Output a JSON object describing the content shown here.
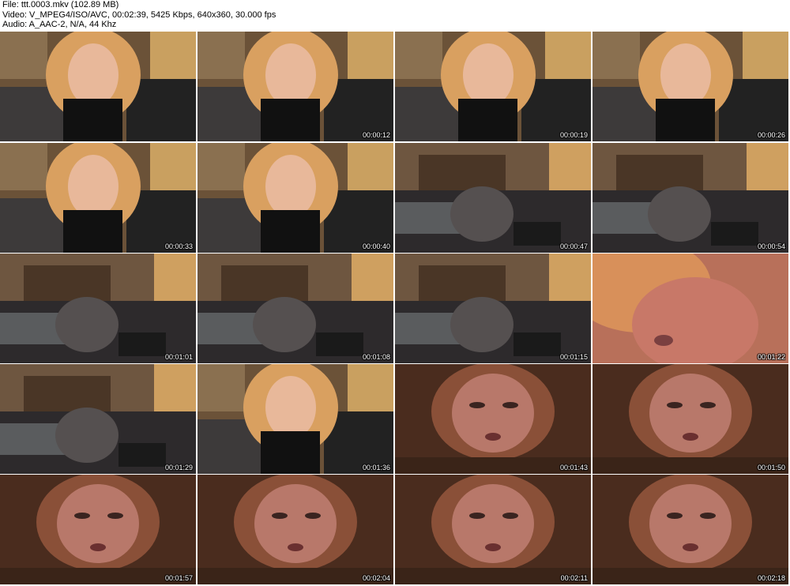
{
  "header": {
    "file_line": "File: ttt.0003.mkv (102.89 MB)",
    "video_line": "Video: V_MPEG4/ISO/AVC, 00:02:39, 5425 Kbps, 640x360, 30.000 fps",
    "audio_line": "Audio: A_AAC-2, N/A, 44 Khz"
  },
  "thumbnails": [
    {
      "time": "",
      "scene": "room-hair"
    },
    {
      "time": "00:00:12",
      "scene": "room-hair"
    },
    {
      "time": "00:00:19",
      "scene": "room-hair"
    },
    {
      "time": "00:00:26",
      "scene": "room-hair"
    },
    {
      "time": "00:00:33",
      "scene": "room-hair"
    },
    {
      "time": "00:00:40",
      "scene": "room-hair"
    },
    {
      "time": "00:00:47",
      "scene": "room-wide"
    },
    {
      "time": "00:00:54",
      "scene": "room-wide"
    },
    {
      "time": "00:01:01",
      "scene": "room-wide"
    },
    {
      "time": "00:01:08",
      "scene": "room-wide"
    },
    {
      "time": "00:01:15",
      "scene": "room-wide"
    },
    {
      "time": "00:01:22",
      "scene": "closeup-red"
    },
    {
      "time": "00:01:29",
      "scene": "room-wide"
    },
    {
      "time": "00:01:36",
      "scene": "room-hair"
    },
    {
      "time": "00:01:43",
      "scene": "closeup-warm"
    },
    {
      "time": "00:01:50",
      "scene": "closeup-warm"
    },
    {
      "time": "00:01:57",
      "scene": "closeup-warm"
    },
    {
      "time": "00:02:04",
      "scene": "closeup-warm"
    },
    {
      "time": "00:02:11",
      "scene": "closeup-warm"
    },
    {
      "time": "00:02:18",
      "scene": "closeup-warm"
    }
  ]
}
